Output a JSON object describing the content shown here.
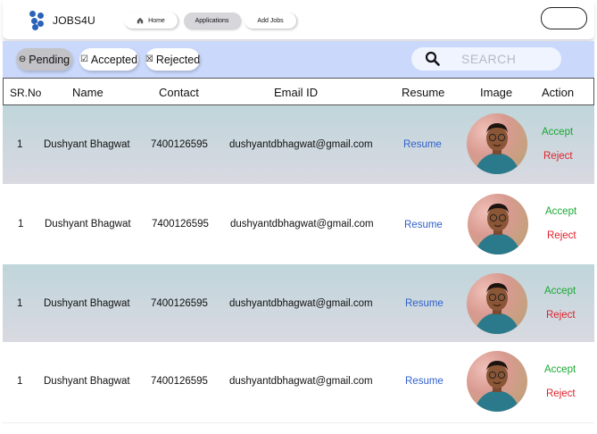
{
  "brand": {
    "name": "JOBS4U"
  },
  "nav": {
    "home": "Home",
    "applications": "Applications",
    "add_jobs": "Add Jobs"
  },
  "filters": {
    "pending": "Pending",
    "accepted": "Accepted",
    "rejected": "Rejected"
  },
  "search": {
    "placeholder": "SEARCH"
  },
  "table": {
    "headers": {
      "srno": "SR.No",
      "name": "Name",
      "contact": "Contact",
      "email": "Email ID",
      "resume": "Resume",
      "image": "Image",
      "action": "Action"
    },
    "rows": [
      {
        "srno": "1",
        "name": "Dushyant Bhagwat",
        "contact": "7400126595",
        "email": "dushyantdbhagwat@gmail.com",
        "resume": "Resume",
        "accept": "Accept",
        "reject": "Reject"
      },
      {
        "srno": "1",
        "name": "Dushyant Bhagwat",
        "contact": "7400126595",
        "email": "dushyantdbhagwat@gmail.com",
        "resume": "Resume",
        "accept": "Accept",
        "reject": "Reject"
      },
      {
        "srno": "1",
        "name": "Dushyant Bhagwat",
        "contact": "7400126595",
        "email": "dushyantdbhagwat@gmail.com",
        "resume": "Resume",
        "accept": "Accept",
        "reject": "Reject"
      },
      {
        "srno": "1",
        "name": "Dushyant Bhagwat",
        "contact": "7400126595",
        "email": "dushyantdbhagwat@gmail.com",
        "resume": "Resume",
        "accept": "Accept",
        "reject": "Reject"
      }
    ]
  },
  "colors": {
    "accept": "#1aa832",
    "reject": "#e0202a",
    "resume_link": "#2f5fcc",
    "filter_bar": "#c9d8fb",
    "logo": "#2a62b8"
  },
  "icons": {
    "logo": "jobs4u-logo-icon",
    "home": "home-icon",
    "pending": "minus-circle-icon",
    "accepted": "checkbox-checked-icon",
    "rejected": "checkbox-x-icon",
    "search": "search-icon"
  }
}
